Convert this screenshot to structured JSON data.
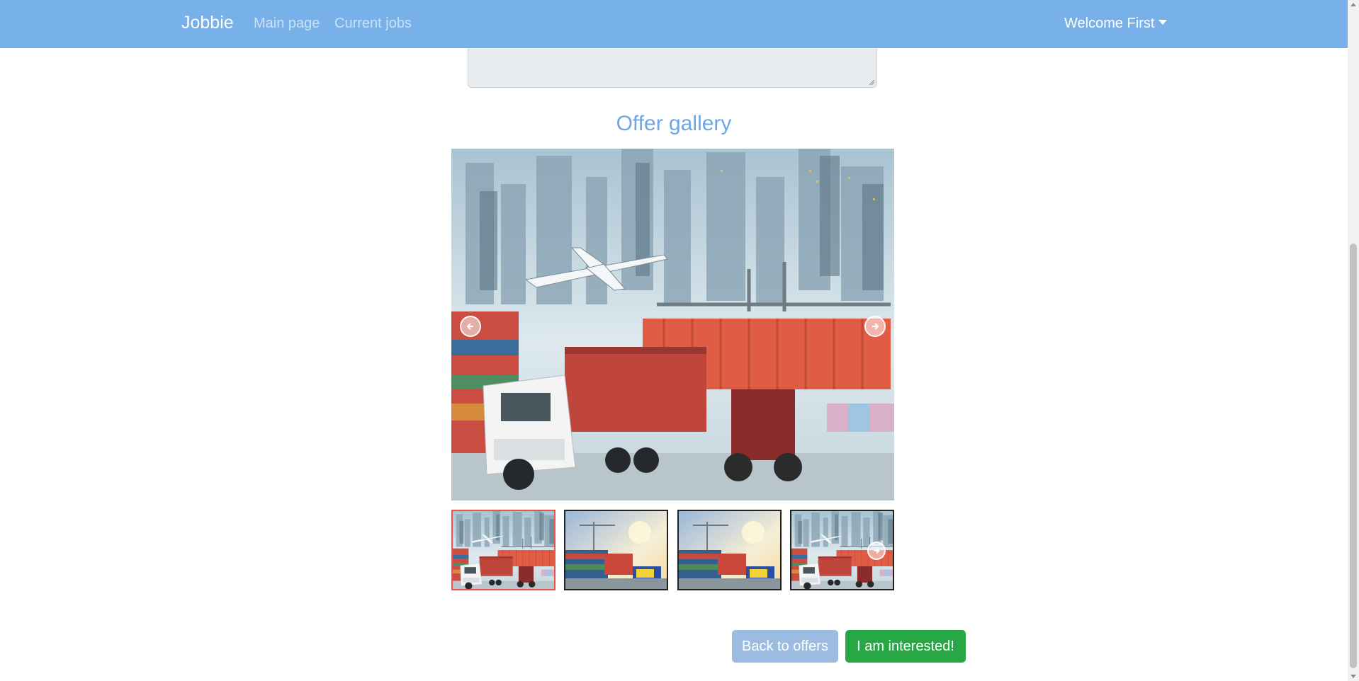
{
  "navbar": {
    "brand": "Jobbie",
    "links": [
      "Main page",
      "Current jobs"
    ],
    "user_menu": "Welcome First",
    "bg_color": "#78b0ea"
  },
  "gallery": {
    "title": "Offer gallery",
    "main_image": "logistics-cargo-photo",
    "thumbnails": [
      {
        "image": "logistics-cargo-photo",
        "active": true
      },
      {
        "image": "port-sunset-cargo-photo",
        "active": false
      },
      {
        "image": "port-sunset-cargo-photo",
        "active": false
      },
      {
        "image": "logistics-cargo-photo",
        "active": false
      }
    ],
    "prev_icon": "chevron-left-icon",
    "next_icon": "chevron-right-icon",
    "active_border_color": "#e8534a"
  },
  "actions": {
    "back_label": "Back to offers",
    "interested_label": "I am interested!",
    "back_color": "#9bbbe0",
    "interested_color": "#28a745"
  }
}
